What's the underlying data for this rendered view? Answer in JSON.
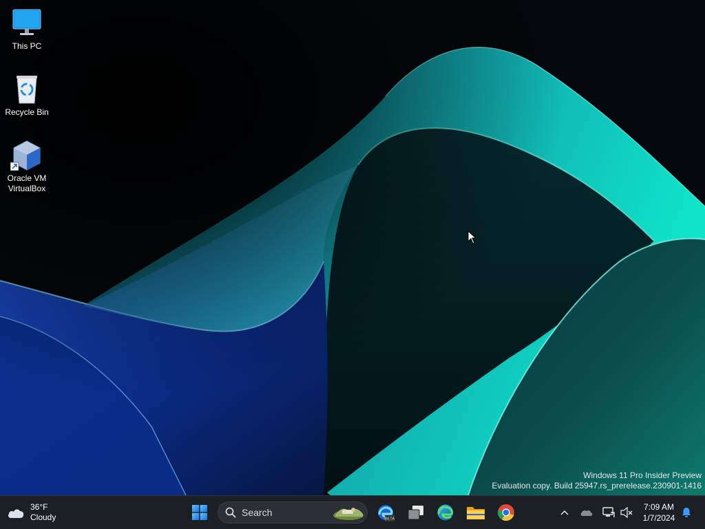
{
  "desktop": {
    "icons": [
      {
        "label": "This PC",
        "icon": "monitor-icon"
      },
      {
        "label": "Recycle Bin",
        "icon": "recycle-bin-icon"
      },
      {
        "label": "Oracle VM VirtualBox",
        "icon": "virtualbox-icon"
      }
    ],
    "watermark": {
      "line1": "Windows 11 Pro Insider Preview",
      "line2": "Evaluation copy. Build 25947.rs_prerelease.230901-1416"
    }
  },
  "taskbar": {
    "weather": {
      "temp": "36°F",
      "condition": "Cloudy",
      "icon": "cloud-icon"
    },
    "start_icon": "windows-logo-icon",
    "search": {
      "placeholder": "Search"
    },
    "pinned": [
      {
        "name": "Microsoft Edge Beta",
        "icon": "edge-beta-icon"
      },
      {
        "name": "Task View",
        "icon": "task-view-icon"
      },
      {
        "name": "Microsoft Edge",
        "icon": "edge-icon"
      },
      {
        "name": "File Explorer",
        "icon": "folder-icon"
      },
      {
        "name": "Google Chrome",
        "icon": "chrome-icon"
      }
    ],
    "tray": {
      "icons": [
        "chevron-up-icon",
        "onedrive-icon",
        "network-icon",
        "speaker-muted-icon",
        "notification-bell-icon"
      ]
    },
    "clock": {
      "time": "7:09 AM",
      "date": "1/7/2024"
    }
  },
  "colors": {
    "taskbar_bg": "#1c1f24",
    "wallpaper_dark": "#05080c",
    "wave_teal": "#16c3b2",
    "wave_blue": "#1a56c9"
  }
}
